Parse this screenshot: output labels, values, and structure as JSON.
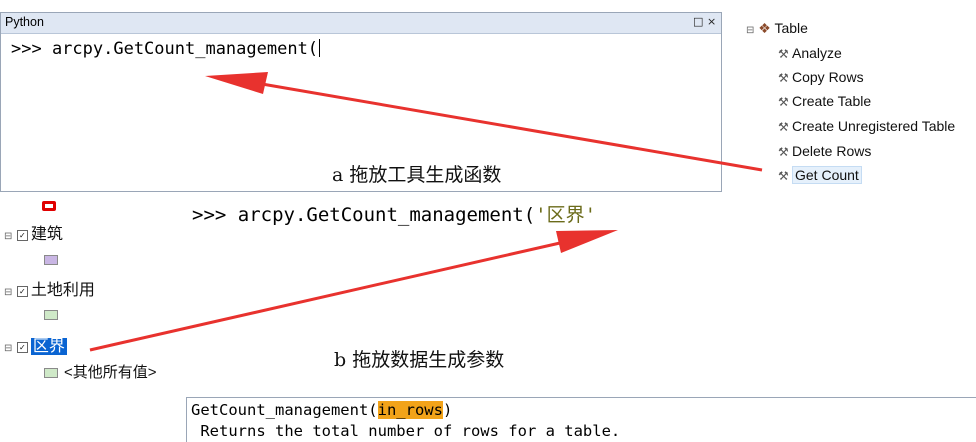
{
  "python_window_a": {
    "title": "Python",
    "pin_icon": "pin-icon",
    "close_label": "×",
    "command_text": ">>> arcpy.GetCount_management("
  },
  "toolbox": {
    "table_label": "Table",
    "tools": [
      "Analyze",
      "Copy Rows",
      "Create Table",
      "Create Unregistered Table",
      "Delete Rows",
      "Get Count"
    ],
    "selected_tool": "Get Count"
  },
  "captions": {
    "a": "a 拖放工具生成函数",
    "b": "b 拖放数据生成参数"
  },
  "toc": {
    "layers": [
      {
        "label": "建筑",
        "checked": true,
        "swatch_color": "#c9b6e4"
      },
      {
        "label": "土地利用",
        "checked": true,
        "swatch_color": "#cfe9c8"
      },
      {
        "label": "区界",
        "checked": true,
        "selected": true
      }
    ],
    "other_values_label": "<其他所有值>",
    "other_swatch_color": "#cfe9c8",
    "top_symbol_color": "#e00000"
  },
  "python_window_b": {
    "command_prefix": ">>> arcpy.GetCount_management(",
    "command_string": "'区界'"
  },
  "help_panel": {
    "signature_prefix": "GetCount_management(",
    "param": "in_rows",
    "signature_suffix": ")",
    "description": " Returns the total number of rows for a table."
  },
  "colors": {
    "arrow": "#e8322e",
    "highlight": "#f2a319",
    "selection": "#0a64d2"
  }
}
